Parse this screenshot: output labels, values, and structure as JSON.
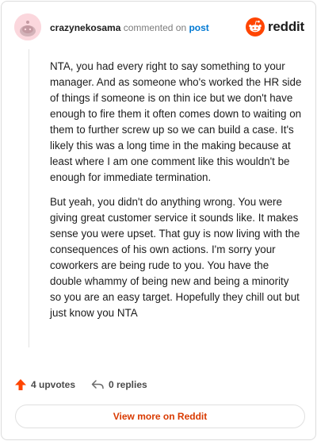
{
  "comment": {
    "username": "crazynekosama",
    "verb": "commented on",
    "post_link": "post",
    "paragraphs": [
      "NTA, you had every right to say something to your manager. And as someone who's worked the HR side of things if someone is on thin ice but we don't have enough to fire them it often comes down to waiting on them to further screw up so we can build a case. It's likely this was a long time in the making because at least where I am one comment like this wouldn't be enough for immediate termination.",
      "But yeah, you didn't do anything wrong. You were giving great customer service it sounds like. It makes sense you were upset. That guy is now living with the consequences of his own actions. I'm sorry your coworkers are being rude to you. You have the double whammy of being new and being a minority so you are an easy target. Hopefully they chill out but just know you NTA"
    ]
  },
  "brand": {
    "name": "reddit",
    "accent": "#ff4500"
  },
  "actions": {
    "upvotes_label": "4 upvotes",
    "replies_label": "0 replies"
  },
  "footer": {
    "view_more_label": "View more on Reddit"
  },
  "colors": {
    "link_blue": "#0079d3",
    "cta_orange": "#d93a00",
    "avatar_bg": "#fbd7dd"
  }
}
